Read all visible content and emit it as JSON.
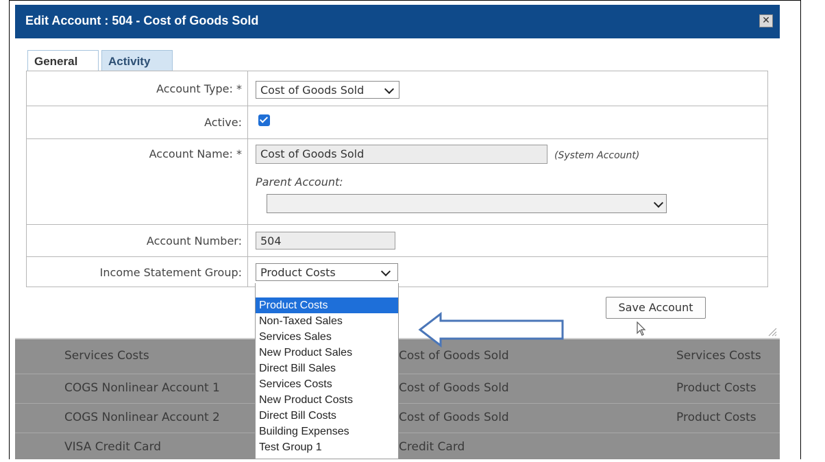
{
  "dialog": {
    "title": "Edit Account : 504 - Cost of Goods Sold",
    "close_label": "✕",
    "tabs": [
      {
        "label": "General",
        "active": true
      },
      {
        "label": "Activity",
        "active": false
      }
    ]
  },
  "form": {
    "account_type": {
      "label": "Account Type: *",
      "value": "Cost of Goods Sold"
    },
    "active": {
      "label": "Active:",
      "checked": true
    },
    "account_name": {
      "label": "Account Name: *",
      "value": "Cost of Goods Sold",
      "note": "(System Account)"
    },
    "parent_account": {
      "label": "Parent Account:",
      "value": ""
    },
    "account_number": {
      "label": "Account Number:",
      "value": "504"
    },
    "income_statement_group": {
      "label": "Income Statement Group:",
      "value": "Product Costs"
    }
  },
  "save_button": "Save Account",
  "dropdown_options": [
    "Product Costs",
    "Non-Taxed Sales",
    "Services Sales",
    "New Product Sales",
    "Direct Bill Sales",
    "Services Costs",
    "New Product Costs",
    "Direct Bill Costs",
    "Building Expenses",
    "Test Group 1"
  ],
  "selected_option": "Product Costs",
  "background_rows": [
    {
      "name": "Services Costs",
      "type": "Cost of Goods Sold",
      "group": "Services Costs"
    },
    {
      "name": "COGS Nonlinear Account 1",
      "type": "Cost of Goods Sold",
      "group": "Product Costs"
    },
    {
      "name": "COGS Nonlinear Account 2",
      "type": "Cost of Goods Sold",
      "group": "Product Costs"
    },
    {
      "name": "VISA Credit Card",
      "type": "Credit Card",
      "group": ""
    }
  ],
  "colors": {
    "titlebar": "#0f4a8a",
    "selected_option": "#1e6fd9",
    "arrow": "#4a76b8",
    "overlay": "#8f8f8f"
  },
  "icons": {
    "close": "close-icon",
    "cursor": "pointer-cursor-icon",
    "arrow": "left-arrow-annotation-icon",
    "checkbox": "checkbox-checked-icon"
  }
}
